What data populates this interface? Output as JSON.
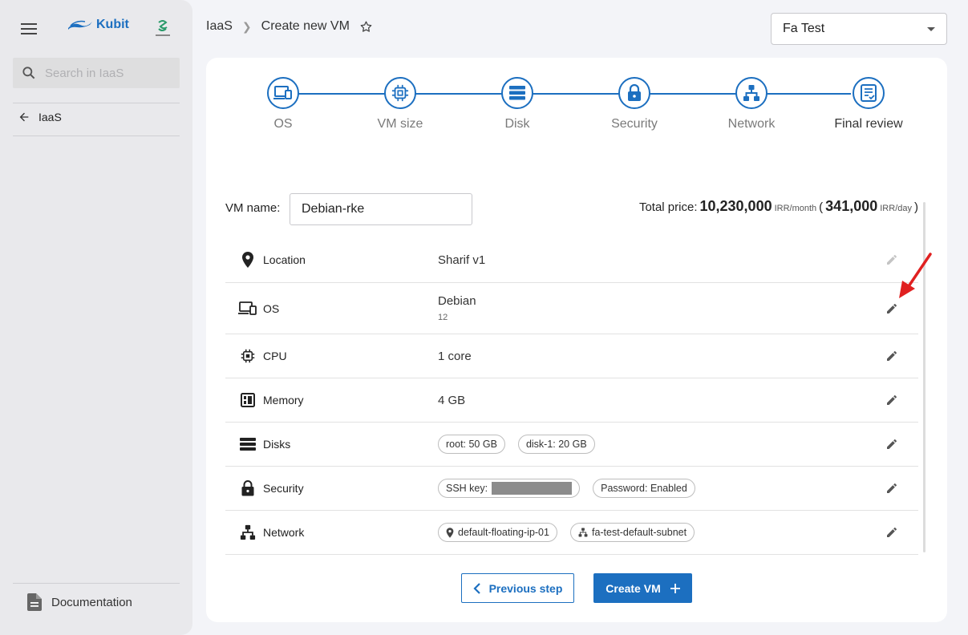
{
  "sidebar": {
    "brand": "Kubit",
    "search_placeholder": "Search in IaaS",
    "back_label": "IaaS",
    "doc_label": "Documentation"
  },
  "header": {
    "breadcrumb_root": "IaaS",
    "breadcrumb_current": "Create new VM",
    "project": "Fa Test"
  },
  "steps": [
    {
      "label": "OS",
      "icon": "laptop-icon",
      "active": false
    },
    {
      "label": "VM size",
      "icon": "chip-icon",
      "active": false
    },
    {
      "label": "Disk",
      "icon": "disk-icon",
      "active": false
    },
    {
      "label": "Security",
      "icon": "lock-icon",
      "active": false
    },
    {
      "label": "Network",
      "icon": "network-icon",
      "active": false
    },
    {
      "label": "Final review",
      "icon": "review-icon",
      "active": true
    }
  ],
  "form": {
    "vm_name_label": "VM name:",
    "vm_name_value": "Debian-rke",
    "total_label": "Total price:",
    "monthly_price": "10,230,000",
    "monthly_unit": "IRR/month",
    "daily_price": "341,000",
    "daily_unit": "IRR/day"
  },
  "review": {
    "location": {
      "name": "Location",
      "value": "Sharif v1"
    },
    "os": {
      "name": "OS",
      "value": "Debian",
      "version": "12"
    },
    "cpu": {
      "name": "CPU",
      "value": "1 core"
    },
    "memory": {
      "name": "Memory",
      "value": "4 GB"
    },
    "disks": {
      "name": "Disks",
      "chips": [
        "root: 50 GB",
        "disk-1: 20 GB"
      ]
    },
    "security": {
      "name": "Security",
      "ssh_label": "SSH key:",
      "password": "Password: Enabled"
    },
    "network": {
      "name": "Network",
      "floating_ip": "default-floating-ip-01",
      "subnet": "fa-test-default-subnet"
    }
  },
  "buttons": {
    "prev": "Previous step",
    "create": "Create VM"
  },
  "colors": {
    "accent": "#1c6fc0",
    "annotation_arrow": "#e02020"
  }
}
